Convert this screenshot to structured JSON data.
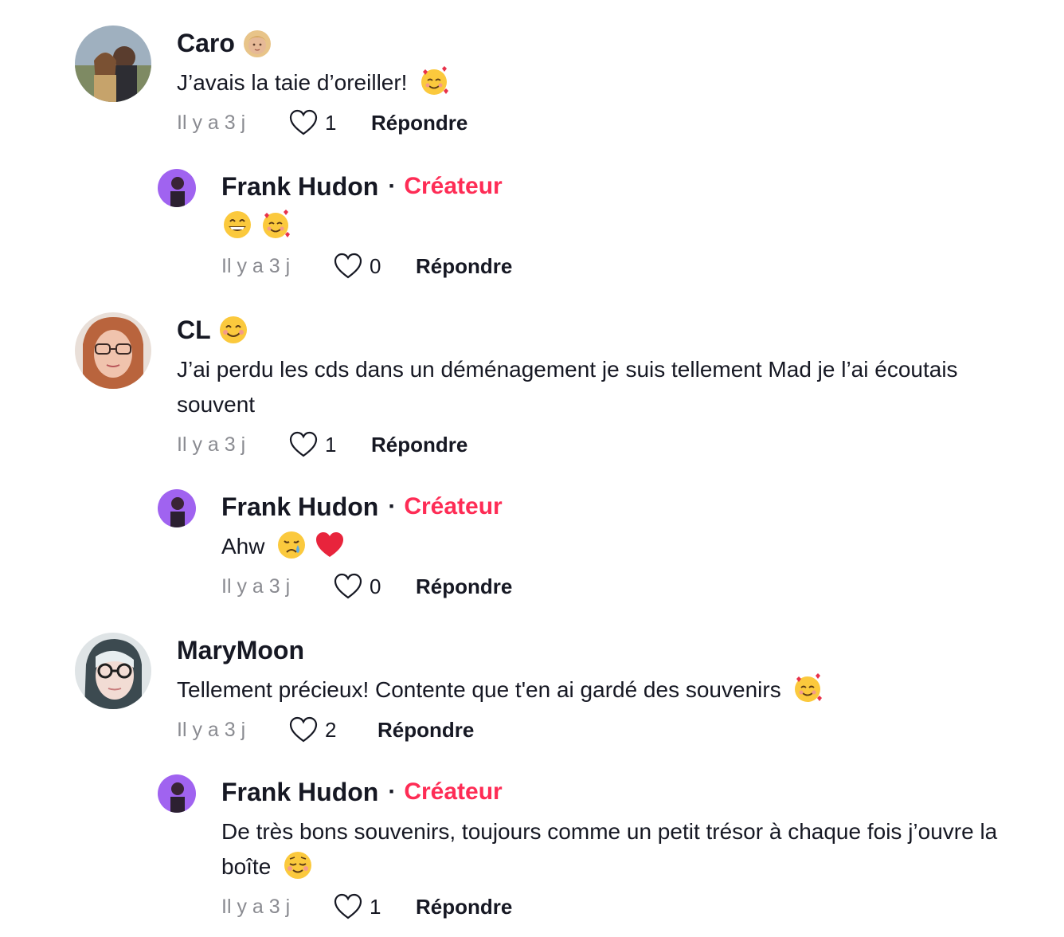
{
  "colors": {
    "text": "#161823",
    "muted": "#8a8b91",
    "creator_accent": "#fe2c55"
  },
  "comments": [
    {
      "username": "Caro",
      "username_emoji": "blonde-person-emoji",
      "text": "J’avais la taie d’oreiller!",
      "text_emoji": "smiling-face-with-hearts-emoji",
      "time": "Il y a 3 j",
      "likes": "1",
      "reply_label": "Répondre",
      "replies": [
        {
          "username": "Frank Hudon",
          "separator": "·",
          "badge": "Créateur",
          "text": "",
          "text_emoji": "grinning-and-hearts-emoji",
          "time": "Il y a 3 j",
          "likes": "0",
          "reply_label": "Répondre"
        }
      ]
    },
    {
      "username": "CL",
      "username_emoji": "smiling-face-emoji",
      "text": "J’ai perdu les cds dans un déménagement je suis tellement Mad je l’ai écoutais souvent",
      "time": "Il y a 3 j",
      "likes": "1",
      "reply_label": "Répondre",
      "replies": [
        {
          "username": "Frank Hudon",
          "separator": "·",
          "badge": "Créateur",
          "text": "Ahw",
          "text_emoji": "crying-face-and-red-heart-emoji",
          "time": "Il y a 3 j",
          "likes": "0",
          "reply_label": "Répondre"
        }
      ]
    },
    {
      "username": "MaryMoon",
      "text": "Tellement précieux! Contente que t'en ai gardé des souvenirs",
      "text_emoji": "smiling-face-with-hearts-emoji",
      "time": "Il y a 3 j",
      "likes": "2",
      "reply_label": "Répondre",
      "replies": [
        {
          "username": "Frank Hudon",
          "separator": "·",
          "badge": "Créateur",
          "text": "De très bons souvenirs, toujours comme un petit trésor à chaque fois j’ouvre la boîte",
          "text_emoji": "relieved-smiling-face-emoji",
          "time": "Il y a 3 j",
          "likes": "1",
          "reply_label": "Répondre"
        }
      ]
    }
  ]
}
